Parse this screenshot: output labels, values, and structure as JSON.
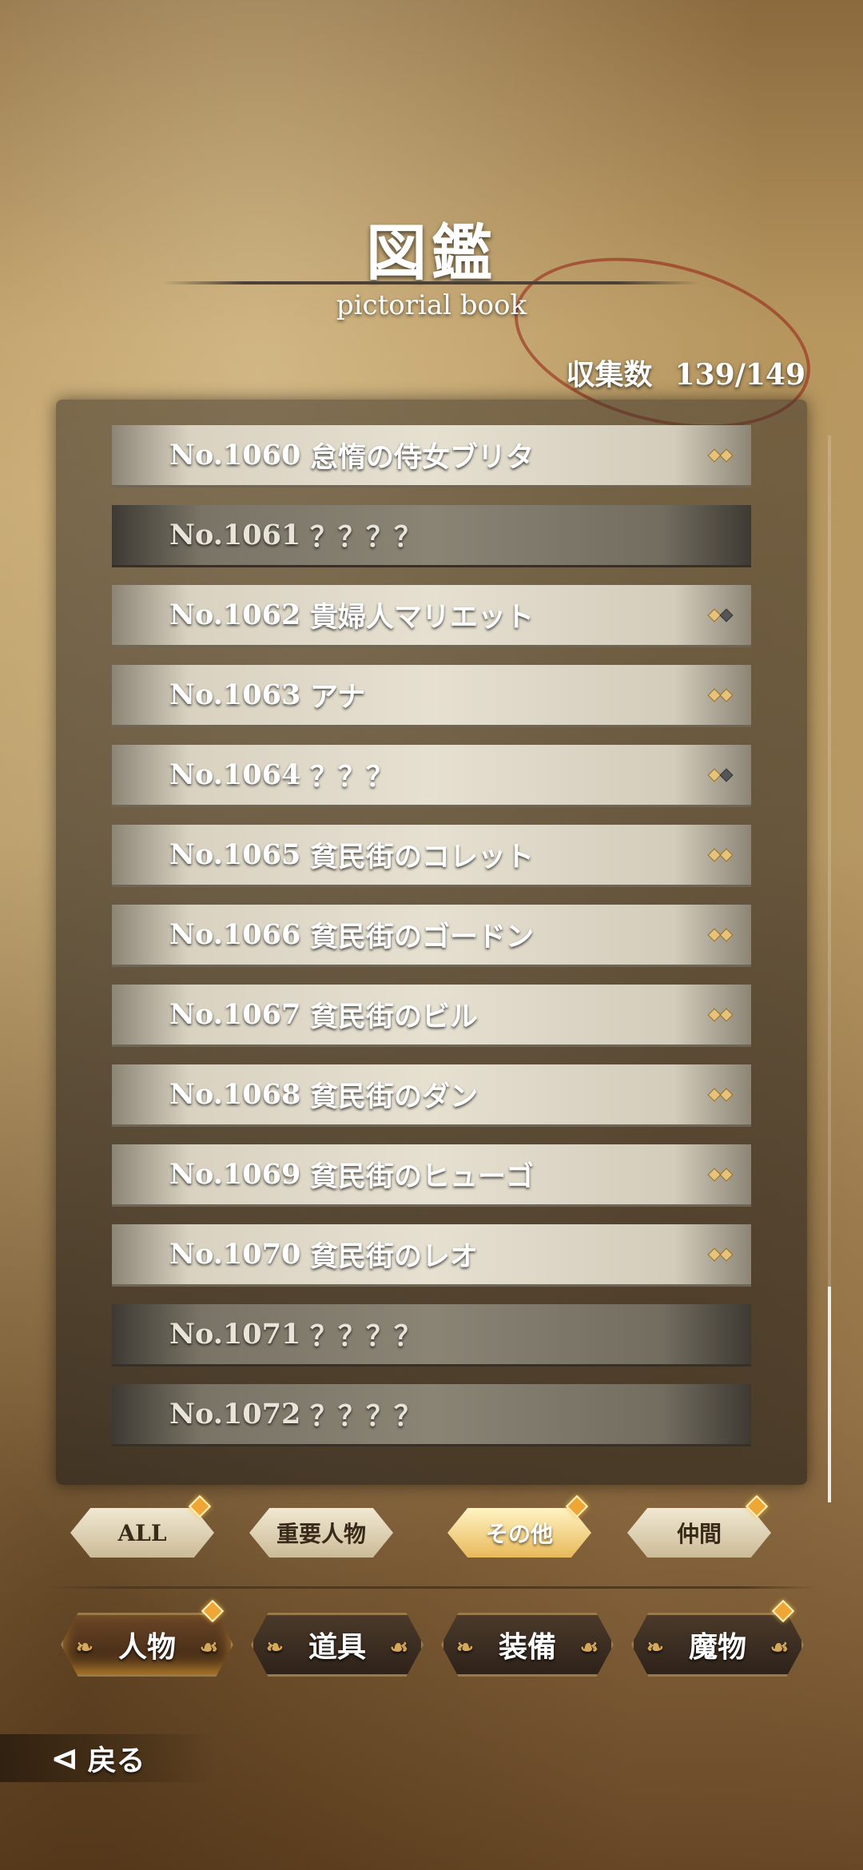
{
  "header": {
    "title": "図鑑",
    "subtitle": "pictorial book",
    "count_label": "収集数",
    "count_value": "139/149"
  },
  "entries": [
    {
      "no": "No.1060",
      "name": "怠惰の侍女ブリタ",
      "known": true,
      "rank": "full"
    },
    {
      "no": "No.1061",
      "name": "？？？？",
      "known": false
    },
    {
      "no": "No.1062",
      "name": "貴婦人マリエット",
      "known": true,
      "rank": "half"
    },
    {
      "no": "No.1063",
      "name": "アナ",
      "known": true,
      "rank": "full"
    },
    {
      "no": "No.1064",
      "name": "？？？",
      "known": true,
      "rank": "half"
    },
    {
      "no": "No.1065",
      "name": "貧民街のコレット",
      "known": true,
      "rank": "full"
    },
    {
      "no": "No.1066",
      "name": "貧民街のゴードン",
      "known": true,
      "rank": "full"
    },
    {
      "no": "No.1067",
      "name": "貧民街のビル",
      "known": true,
      "rank": "full"
    },
    {
      "no": "No.1068",
      "name": "貧民街のダン",
      "known": true,
      "rank": "full"
    },
    {
      "no": "No.1069",
      "name": "貧民街のヒューゴ",
      "known": true,
      "rank": "full"
    },
    {
      "no": "No.1070",
      "name": "貧民街のレオ",
      "known": true,
      "rank": "full"
    },
    {
      "no": "No.1071",
      "name": "？？？？",
      "known": false
    },
    {
      "no": "No.1072",
      "name": "？？？？",
      "known": false
    }
  ],
  "filters": [
    {
      "label": "ALL",
      "active": false,
      "badge": true
    },
    {
      "label": "重要人物",
      "active": false,
      "badge": false
    },
    {
      "label": "その他",
      "active": true,
      "badge": true
    },
    {
      "label": "仲間",
      "active": false,
      "badge": true
    }
  ],
  "categories": [
    {
      "label": "人物",
      "active": true,
      "badge": true
    },
    {
      "label": "道具",
      "active": false,
      "badge": false
    },
    {
      "label": "装備",
      "active": false,
      "badge": false
    },
    {
      "label": "魔物",
      "active": false,
      "badge": true
    }
  ],
  "back_label": "戻る",
  "colors": {
    "accent": "#e8b95a",
    "badge": "#f0a635"
  }
}
